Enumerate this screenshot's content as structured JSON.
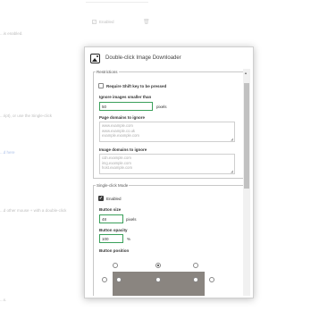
{
  "background": {
    "enabled_label": "Enabled",
    "lines": [
      "...is enabled.",
      "...ript), or use the Single-click",
      "...d here",
      "...d other mouse + with a double-click",
      "...s."
    ]
  },
  "popup": {
    "title": "Double-click Image Downloader",
    "restrictions": {
      "legend": "Restrictions",
      "require_shift_label": "Require Shift key to be pressed",
      "ignore_smaller_label": "Ignore images smaller than",
      "ignore_smaller_value": "50",
      "ignore_smaller_unit": "pixels",
      "page_domains_label": "Page domains to ignore",
      "page_domains_placeholder": [
        "www.example.com",
        "www.example.co.uk",
        "example.example.com"
      ],
      "image_domains_label": "Image domains to ignore",
      "image_domains_placeholder": [
        "cdn.example.com",
        "img.example.com",
        "host.example.com"
      ]
    },
    "single_click": {
      "legend": "Single-click Mode",
      "enabled_label": "Enabled",
      "button_size_label": "Button size",
      "button_size_value": "48",
      "button_size_unit": "pixels",
      "button_opacity_label": "Button opacity",
      "button_opacity_value": "100",
      "button_opacity_unit": "%",
      "button_position_label": "Button position"
    }
  },
  "colors": {
    "valid_border": "#3aa05a",
    "position_preview": "#8a8580"
  }
}
